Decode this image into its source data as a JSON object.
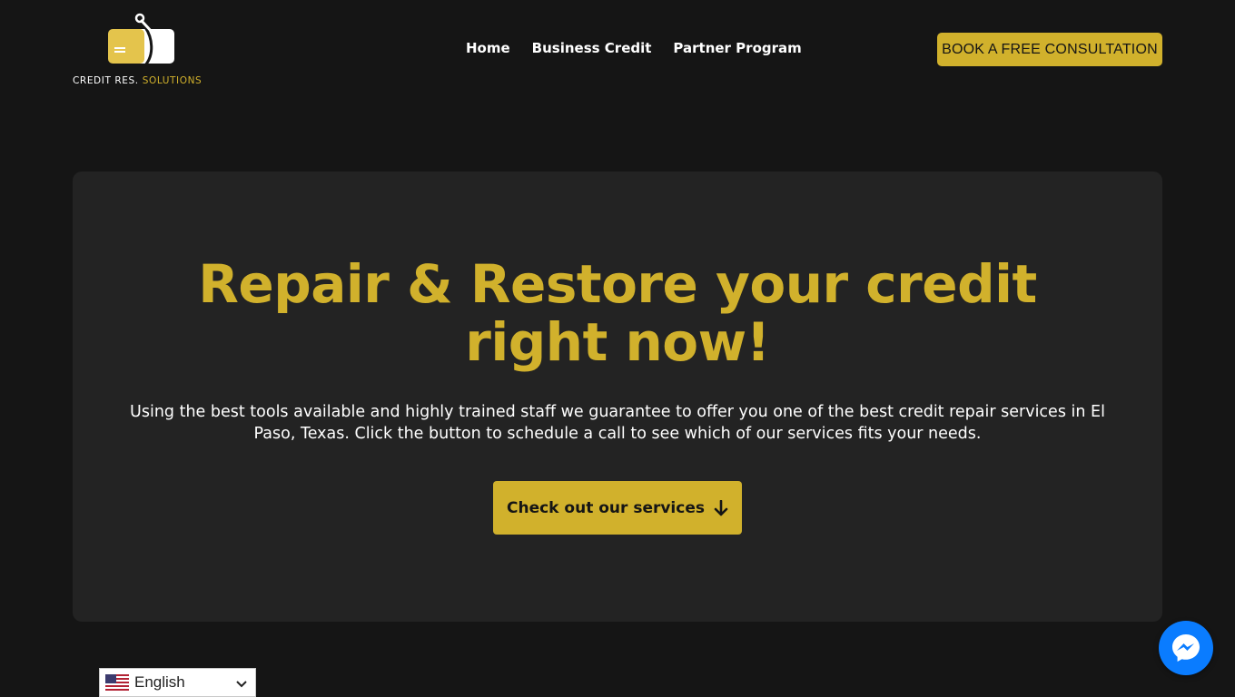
{
  "header": {
    "logo": {
      "text_main": "CREDIT RES.",
      "text_accent": "SOLUTIONS",
      "icon": "credit-card-wrench-icon"
    },
    "nav": {
      "items": [
        "Home",
        "Business Credit",
        "Partner Program"
      ]
    },
    "cta_label": "BOOK A FREE CONSULTATION"
  },
  "hero": {
    "title": "Repair & Restore your credit right now!",
    "text": "Using the best tools available and highly trained staff we guarantee to offer you one of the best credit repair services in El Paso, Texas. Click the button to schedule a call to see which of our services fits your needs.",
    "button_label": "Check out our services",
    "button_icon": "arrow-down-icon"
  },
  "language_selector": {
    "selected": "English",
    "flag_icon": "us-flag-icon"
  },
  "chat_widget": {
    "icon": "messenger-icon"
  },
  "colors": {
    "background": "#151515",
    "card": "#232323",
    "accent": "#d1b12c",
    "text": "#ffffff",
    "messenger": "#0a7cff"
  }
}
